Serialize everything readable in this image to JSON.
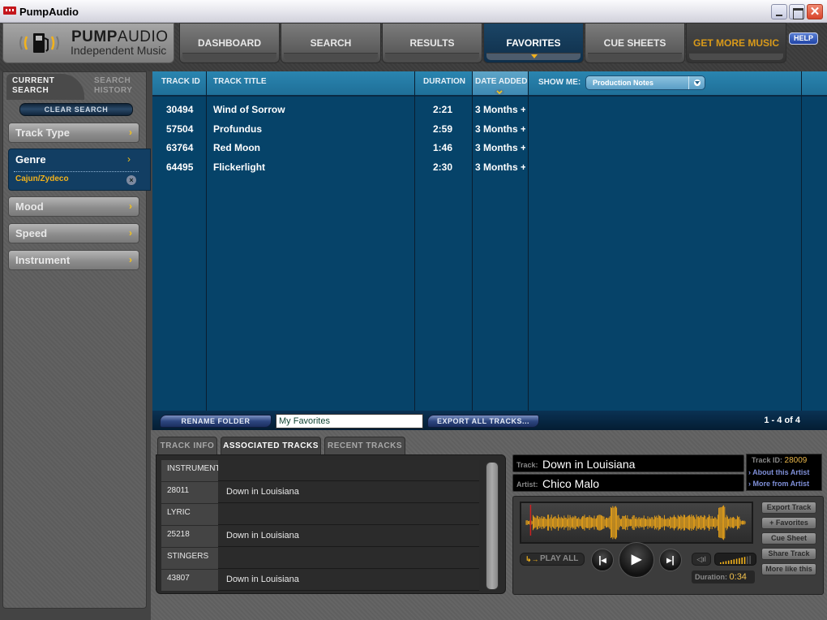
{
  "window": {
    "title": "PumpAudio",
    "controls": [
      "minimize",
      "maximize",
      "close"
    ]
  },
  "logo": {
    "brand_bold": "PUMP",
    "brand_light": "AUDIO",
    "tagline": "Independent Music"
  },
  "nav": {
    "items": [
      {
        "label": "DASHBOARD",
        "active": false
      },
      {
        "label": "SEARCH",
        "active": false
      },
      {
        "label": "RESULTS",
        "active": false
      },
      {
        "label": "FAVORITES",
        "active": true
      },
      {
        "label": "CUE SHEETS",
        "active": false
      },
      {
        "label": "GET MORE MUSIC",
        "active": false
      }
    ],
    "help_label": "HELP"
  },
  "sidebar": {
    "tab_current": "CURRENT\nSEARCH",
    "tab_current_l1": "CURRENT",
    "tab_current_l2": "SEARCH",
    "tab_history_l1": "SEARCH",
    "tab_history_l2": "HISTORY",
    "clear_search": "CLEAR SEARCH",
    "filters": [
      {
        "label": "Track Type"
      },
      {
        "label": "Genre",
        "selected_value": "Cajun/Zydeco"
      },
      {
        "label": "Mood"
      },
      {
        "label": "Speed"
      },
      {
        "label": "Instrument"
      }
    ],
    "chevron": "›",
    "remove_glyph": "×"
  },
  "tracklist": {
    "columns": {
      "id": "TRACK ID",
      "title": "TRACK TITLE",
      "duration": "DURATION",
      "date_added": "DATE ADDED"
    },
    "sorted_by": "DATE ADDED",
    "show_me_label": "SHOW ME:",
    "show_me_value": "Production Notes",
    "rows": [
      {
        "id": "30494",
        "title": "Wind of Sorrow",
        "duration": "2:21",
        "date_added": "3 Months +"
      },
      {
        "id": "57504",
        "title": "Profundus",
        "duration": "2:59",
        "date_added": "3 Months +"
      },
      {
        "id": "63764",
        "title": "Red Moon",
        "duration": "1:46",
        "date_added": "3 Months +"
      },
      {
        "id": "64495",
        "title": "Flickerlight",
        "duration": "2:30",
        "date_added": "3 Months +"
      }
    ],
    "rename_folder": "RENAME FOLDER",
    "folder_name": "My Favorites",
    "export_all": "EXPORT ALL TRACKS...",
    "pager": "1 - 4 of 4"
  },
  "lower_tabs": [
    {
      "label": "TRACK INFO",
      "active": false
    },
    {
      "label": "ASSOCIATED TRACKS",
      "active": true
    },
    {
      "label": "RECENT TRACKS",
      "active": false
    }
  ],
  "associated": [
    {
      "type": "header",
      "c1": "INSTRUMENTAL",
      "c2": ""
    },
    {
      "type": "track",
      "c1": "28011",
      "c2": "Down in Louisiana"
    },
    {
      "type": "header",
      "c1": "LYRIC",
      "c2": ""
    },
    {
      "type": "track",
      "c1": "25218",
      "c2": "Down in Louisiana"
    },
    {
      "type": "header",
      "c1": "STINGERS",
      "c2": ""
    },
    {
      "type": "track",
      "c1": "43807",
      "c2": "Down in Louisiana"
    }
  ],
  "player": {
    "track_label": "Track:",
    "track": "Down in Louisiana",
    "artist_label": "Artist:",
    "artist": "Chico Malo",
    "track_id_label": "Track ID:",
    "track_id": "28009",
    "about_artist": "About this Artist",
    "more_from_artist": "More from Artist",
    "play_all": "PLAY ALL",
    "duration_label": "Duration:",
    "duration": "0:34",
    "playhead_fraction": 0.02,
    "volume_fraction": 0.85,
    "actions": [
      "Export Track",
      "+ Favorites",
      "Cue Sheet",
      "Share Track",
      "More like this"
    ],
    "colors": {
      "waveform": "#f2a818",
      "accent": "#f2b21c"
    }
  }
}
